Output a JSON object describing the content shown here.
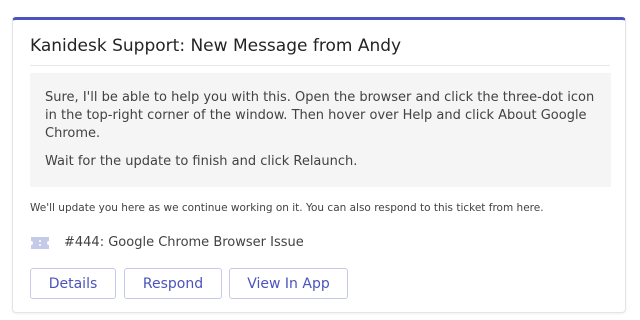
{
  "card": {
    "title": "Kanidesk Support: New Message from Andy",
    "message": {
      "paragraph_1": "Sure, I'll be able to help you with this. Open the browser and click the three-dot icon in the top-right corner of the window. Then hover over Help and click About Google Chrome.",
      "paragraph_2": "Wait for the update to finish and click Relaunch."
    },
    "update_note": "We'll update you here as we continue working on it. You can also respond to this ticket from here.",
    "ticket": {
      "icon": "ticket-icon",
      "label": "#444: Google Chrome Browser Issue"
    },
    "buttons": {
      "details": "Details",
      "respond": "Respond",
      "view_in_app": "View In App"
    }
  },
  "colors": {
    "accent": "#4b53bc",
    "ticket_icon": "#c5cae9",
    "message_background": "#f5f5f5"
  }
}
